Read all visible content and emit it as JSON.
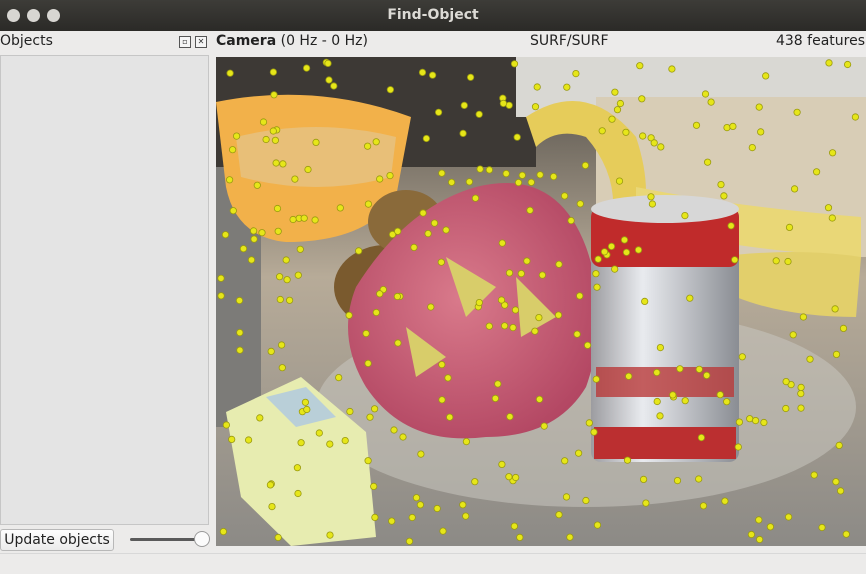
{
  "window": {
    "title": "Find-Object"
  },
  "dock": {
    "title": "Objects",
    "float_icon": "float-icon",
    "close_icon": "close-icon",
    "update_button": "Update objects",
    "slider_value": 1.0
  },
  "camera": {
    "title": "Camera",
    "rate": "(0 Hz - 0 Hz)",
    "algorithm": "SURF/SURF",
    "feature_count": "438 features"
  },
  "colors": {
    "keypoint": "#e6e619",
    "titlebar": "#2f2e2b"
  }
}
